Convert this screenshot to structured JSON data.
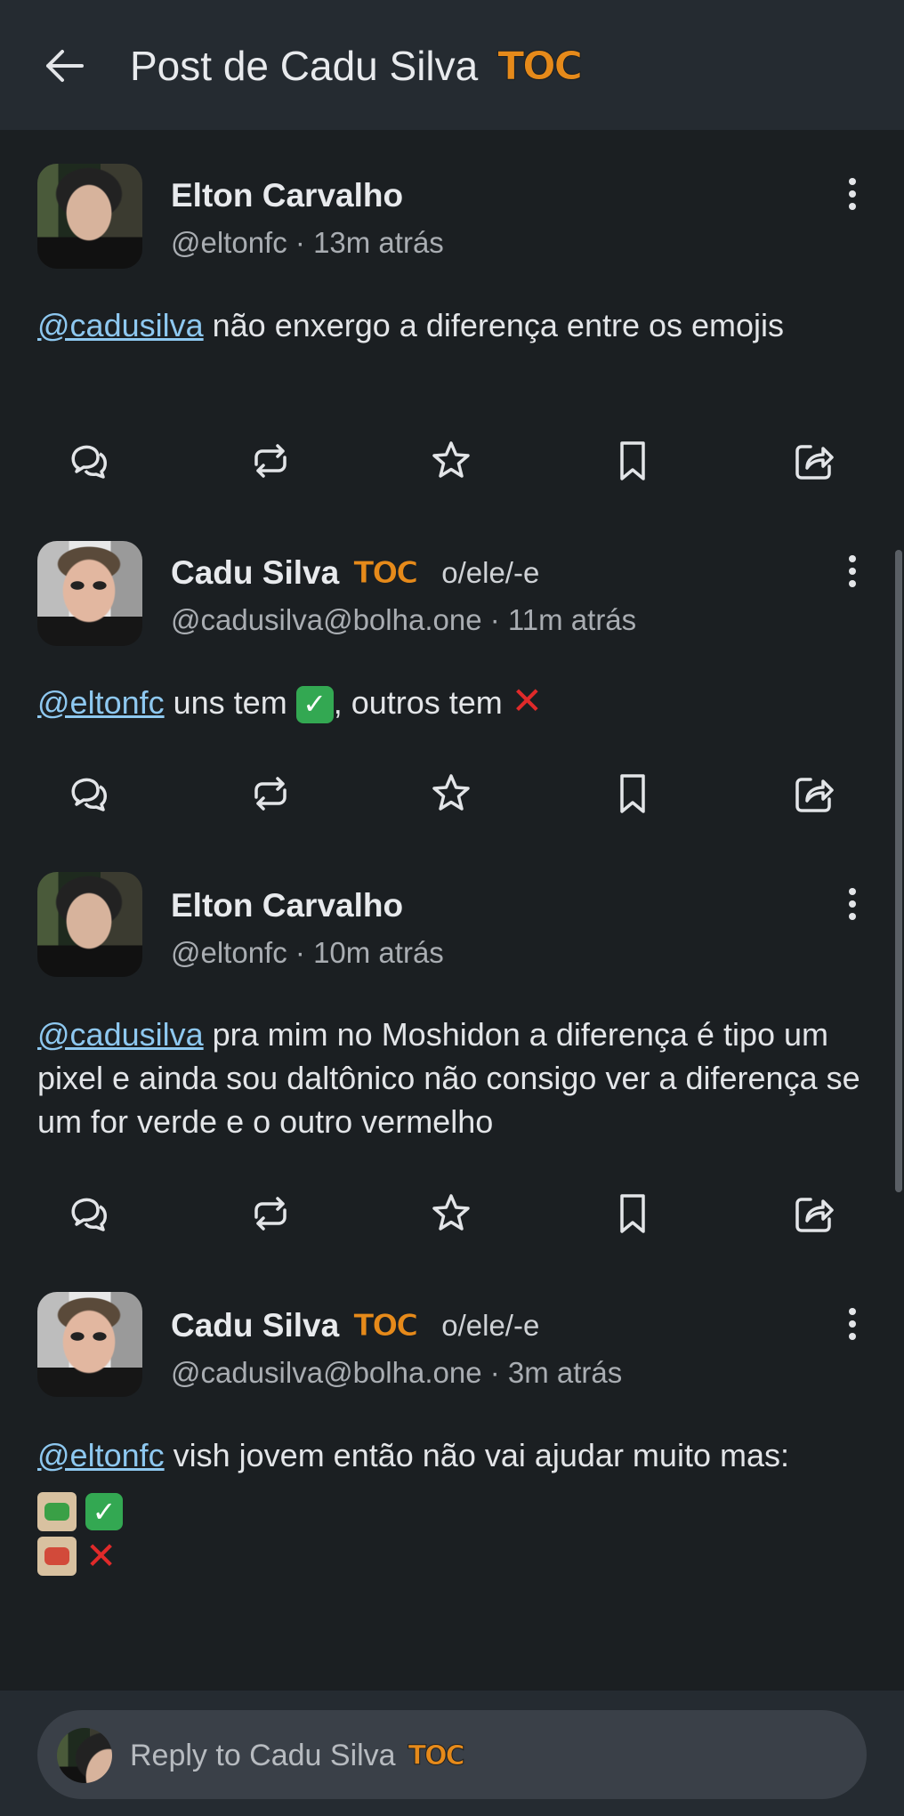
{
  "header": {
    "back_icon": "arrow-left-icon",
    "title": "Post de Cadu Silva",
    "title_badge": "TOC"
  },
  "colors": {
    "background": "#1b1f22",
    "header": "#252b31",
    "mention": "#8ec8f0",
    "toc_badge": "#e68a1a"
  },
  "posts": [
    {
      "name": "Elton Carvalho",
      "badge": "",
      "pronouns": "",
      "handle": "@eltonfc",
      "time": "· 13m atrás",
      "mention": "@cadusilva",
      "text": " não enxergo a diferença entre os emojis"
    },
    {
      "name": "Cadu Silva",
      "badge": "TOC",
      "pronouns": "o/ele/-e",
      "handle": "@cadusilva@bolha.one",
      "time": "· 11m atrás",
      "mention": "@eltonfc",
      "text_a": " uns tem ",
      "text_b": ", outros tem "
    },
    {
      "name": "Elton Carvalho",
      "badge": "",
      "pronouns": "",
      "handle": "@eltonfc",
      "time": "· 10m atrás",
      "mention": "@cadusilva",
      "text": " pra mim no Moshidon a diferença é tipo um pixel e ainda sou daltônico não consigo ver a diferença se um for verde e o outro vermelho"
    },
    {
      "name": "Cadu Silva",
      "badge": "TOC",
      "pronouns": "o/ele/-e",
      "handle": "@cadusilva@bolha.one",
      "time": "· 3m atrás",
      "mention": "@eltonfc",
      "text": " vish jovem então não vai ajudar muito mas:"
    }
  ],
  "actions": [
    "reply-icon",
    "boost-icon",
    "favorite-icon",
    "bookmark-icon",
    "share-icon"
  ],
  "reply": {
    "placeholder": "Reply to Cadu Silva",
    "badge": "TOC"
  }
}
